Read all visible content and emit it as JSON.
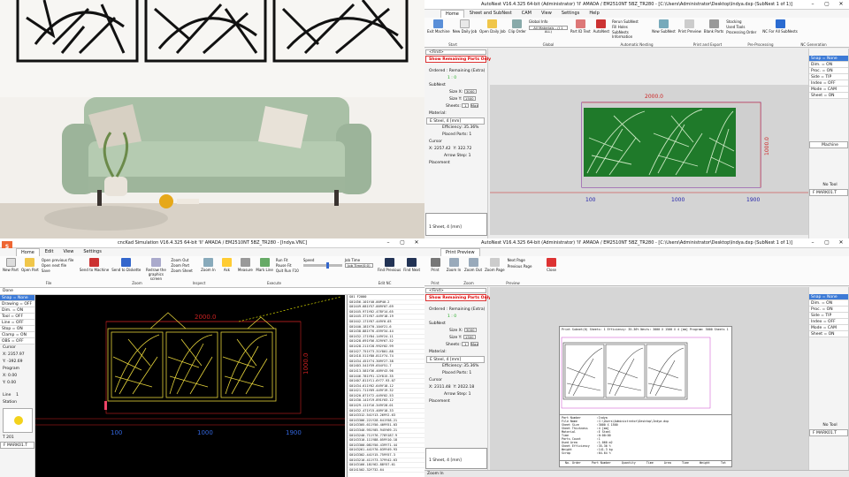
{
  "tl": {
    "description_hidden": true
  },
  "tr": {
    "title": "AutoNest V16.4.325 64-bit (Administrator)  'II'  AMADA / EM2510NT  5BZ_TR280  - [C:\\Users\\Administrator\\Desktop\\Indya.dxp (SubNest 1 of 1)]",
    "tabs": [
      "Home",
      "Sheet and SubNest",
      "CAM",
      "View",
      "Settings",
      "Help"
    ],
    "ribbon": [
      "Exit Machine",
      "New Daily Job",
      "Open Daily Job",
      "Clip Order",
      "Part ID Text",
      "AutoNest",
      "Rerun SubNest",
      "Fill Holes",
      "SubNests Information",
      "New SubNest",
      "Print Preview",
      "Blank Parts",
      "Stocking",
      "Used Tools",
      "Processing Order",
      "NC For All SubNests"
    ],
    "groups": [
      "Start",
      "Global",
      "Automatic Nesting",
      "Print and Export",
      "Pre-Processing",
      "NC Generation"
    ],
    "global_info": "Global Info",
    "materials": "All Materials - (I 1 ALL)",
    "find": "<Find>",
    "show_remaining": "Show Remaining Parts Only",
    "ordered_label": "Ordered : Remaining (Extra)",
    "ordered_val": "1 : 0",
    "subnest": "SubNest",
    "size_x": "3000",
    "size_y": "1500",
    "sheets": "1",
    "max": "Max",
    "material_lbl": "Material:",
    "material": "E Steel, 4 [mm]",
    "efficiency": "Efficiency: 35.36%",
    "placed": "Placed Parts: 1",
    "cursor": "Cursor",
    "cx": "2257.42",
    "cy": "322.72",
    "arrow_step": "Arrow Step: 1",
    "placement": "Placement",
    "sheet_item": "1  Sheet, 4 [mm]",
    "dim_top": "2000.0",
    "dim_side": "1000.0",
    "ticks": [
      "100",
      "1000",
      "1900"
    ],
    "right_list": [
      "Snap = None",
      "Dim. = ON",
      "Proc. = ON",
      "Side = TIP",
      "Index = OFF",
      "Mode = CAM",
      "Sheet = ON"
    ],
    "machine": "Machine",
    "no_tool": "No Tool",
    "marker": "F MARK01.T"
  },
  "bl": {
    "title": "cncKad Simulation V16.4.325 64-bit  'II'  AMADA / EM2510NT  5BZ_TR280  - [Indya.VNC]",
    "tabs": [
      "Home",
      "Edit",
      "View",
      "Settings"
    ],
    "ribbon": [
      "New Part",
      "Open Part",
      "Open previous file",
      "Open next file",
      "Save",
      "Send to Machine",
      "Send to Diskette",
      "Redraw the graphics screen",
      "Zoom Out",
      "Zoom Part",
      "Zoom Sheet",
      "Zoom In",
      "Ask",
      "Measure",
      "Mark Line",
      "Run Fit",
      "Pause Fit",
      "Quit Run F10",
      "Speed",
      "Job Time",
      "Find Previous",
      "Find Next"
    ],
    "groups": [
      "File",
      "Zoom",
      "Inspect",
      "Execute",
      "Edit NC"
    ],
    "done": "Done",
    "left_list": [
      "Snap = None",
      "Drawing = OFF",
      "Dim. = ON",
      "Tool = OFF",
      "Line = OFF",
      "Stop = ON",
      "Clamp = ON",
      "OBS = OFF"
    ],
    "cursor": "Cursor",
    "x": "2357.97",
    "y": "-392.69",
    "program": "Program",
    "px": "0.00",
    "py": "0.00",
    "line": "Line",
    "line_val": "1",
    "station": "Station",
    "t": "T 201",
    "marker": "F MARK01.T",
    "job_time": "Job Time(0:0)",
    "dim_top": "2000.0",
    "dim_side": "1000.0",
    "ticks": [
      "100",
      "1000",
      "1900"
    ],
    "nc": [
      "G01 F2000",
      "G01X56.101Y40.00P40.2",
      "G01X49.681Y57.009Y07.69",
      "G01X45.971Y62.478Y14.65",
      "G01X45.371Y67.449Y18.19",
      "G01X42.171Y67.449Y0.03",
      "G01X40.181Y70.104Y21.6",
      "G01X38.881Y76.459Y34.44",
      "G01X32.171Y84.149Y24.11",
      "G01X28.691Y56.529Y67.52",
      "G01X28.211Y28.992Y02.99",
      "G01X27.751Y73.31Y801.88",
      "G01X18.511Y80.811Y74.74",
      "G01X34.451Y74.309Y27.38",
      "G01X03.541Y59.654Y51.7",
      "G01X13.581Y36.409Y43.96",
      "G01X46.781Y91.12Y815.35",
      "G01X07.811Y11.6Y77.93.07",
      "G01X34.611Y62.649Y18.12",
      "G01X21.711Y69.449Y19.32",
      "G01X20.871Y72.449Y02.53",
      "G01X30.141Y19.891Y03.12",
      "G01X29.111Y16.349Y28.01",
      "G01X32.471Y15.409Y18.33",
      "G01X3312.541Y13.269Y2.63",
      "G01X3306.221Y28.641Y58.21",
      "G01X3305.611Y50.409Y51.03",
      "G01X3340.951Y05.945Y69.21",
      "G01X3240.711Y76.778Y187.9",
      "G01X3310.111Y88.059Y10.18",
      "G01X3300.081Y50.439Y71.44",
      "G01X3261.441Y70.039Y49.93",
      "G01X3302.441Y15.759Y57.3",
      "G01X3210.411Y73.379Y42.63",
      "G01X3166.181Y62.88Y57.61",
      "G01X1502.32Y732.64"
    ],
    "status": "Done"
  },
  "br": {
    "title": "AutoNest V16.4.325 64-bit (Administrator)  'II'  AMADA / EM2510NT  5BZ_TR280  - [C:\\Users\\Administrator\\Desktop\\Indya.dxp (SubNest 1 of 1)]",
    "tabs": [
      "Print Preview"
    ],
    "ribbon": [
      "Print",
      "Zoom In",
      "Zoom Out",
      "Zoom Page",
      "Next Page",
      "Previous Page",
      "Close"
    ],
    "groups": [
      "Print",
      "Zoom",
      "Preview"
    ],
    "find": "<Find>",
    "show_remaining": "Show Remaining Parts Only",
    "ordered_label": "Ordered : Remaining (Extra)",
    "ordered_val": "1 : 0",
    "subnest": "SubNest",
    "size_x": "3000",
    "size_y": "1500",
    "sheets": "1",
    "max": "Max",
    "material_lbl": "Material:",
    "material": "E Steel, 4 [mm]",
    "efficiency": "Efficiency: 35.36%",
    "placed": "Placed Parts: 1",
    "cursor": "Cursor",
    "cx": "2311.48",
    "cy": "2022.18",
    "arrow_step": "Arrow Step: 1",
    "placement": "Placement",
    "sheet_item": "1  Sheet, 4 [mm]",
    "right_list": [
      "Snap = None",
      "Dim. = ON",
      "Proc. = ON",
      "Side = TIP",
      "Index = OFF",
      "Mode = CAM",
      "Sheet = ON"
    ],
    "no_tool": "No Tool",
    "marker": "F MARK01.T",
    "status": "Zoom In",
    "page_header": "Print Subnet(0)   Sheets: 1  Efficiency: 35.36%  Nests: 3000 X 1500 X 4 [mm]   Program: 5000 Sheets 1",
    "report_lines": [
      "Part Number",
      "File Name",
      "Sheet Size",
      "Sheet Thickness",
      "Material",
      "Time",
      "Parts Count",
      "Used Area",
      "Sheet Efficiency",
      "Weight",
      "Scrap"
    ],
    "report_vals": [
      ":Indya",
      ":C:\\Users\\Administrator\\Desktop\\Indya.dxp",
      ":3000 X 1500",
      ":4 [mm]",
      ":E Steel",
      ":0:00:00",
      ":1",
      ":1.060 m2",
      ":35.36 %",
      ":141.3 kg",
      ":64.64 %"
    ],
    "report_footer": [
      "No. Order",
      "Part Number",
      "Quantity",
      "Time",
      "Area",
      "Time",
      "Weight",
      "Tot"
    ]
  }
}
